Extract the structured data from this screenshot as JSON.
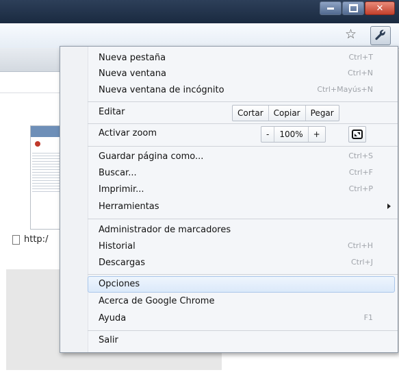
{
  "window": {
    "buttons": {
      "minimize": "minimize-icon",
      "maximize": "maximize-icon",
      "close": "close-icon"
    }
  },
  "toolbar": {
    "bookmark_icon": "star-icon",
    "menu_icon": "wrench-icon"
  },
  "page": {
    "url_fragment": "http:/"
  },
  "menu": {
    "new_tab": {
      "label": "Nueva pestaña",
      "shortcut": "Ctrl+T"
    },
    "new_window": {
      "label": "Nueva ventana",
      "shortcut": "Ctrl+N"
    },
    "incognito": {
      "label": "Nueva ventana de incógnito",
      "shortcut": "Ctrl+Mayús+N"
    },
    "edit": {
      "label": "Editar",
      "cut": "Cortar",
      "copy": "Copiar",
      "paste": "Pegar"
    },
    "zoom": {
      "label": "Activar zoom",
      "minus": "-",
      "value": "100%",
      "plus": "+"
    },
    "save_page": {
      "label": "Guardar página como...",
      "shortcut": "Ctrl+S"
    },
    "find": {
      "label": "Buscar...",
      "shortcut": "Ctrl+F"
    },
    "print": {
      "label": "Imprimir...",
      "shortcut": "Ctrl+P"
    },
    "tools": {
      "label": "Herramientas"
    },
    "bookmark_manager": {
      "label": "Administrador de marcadores"
    },
    "history": {
      "label": "Historial",
      "shortcut": "Ctrl+H"
    },
    "downloads": {
      "label": "Descargas",
      "shortcut": "Ctrl+J"
    },
    "options": {
      "label": "Opciones"
    },
    "about": {
      "label": "Acerca de Google Chrome"
    },
    "help": {
      "label": "Ayuda",
      "shortcut": "F1"
    },
    "exit": {
      "label": "Salir"
    }
  },
  "colors": {
    "highlight": "#dbe9fa",
    "titlebar": "#1a2a40",
    "close": "#c2402c"
  }
}
